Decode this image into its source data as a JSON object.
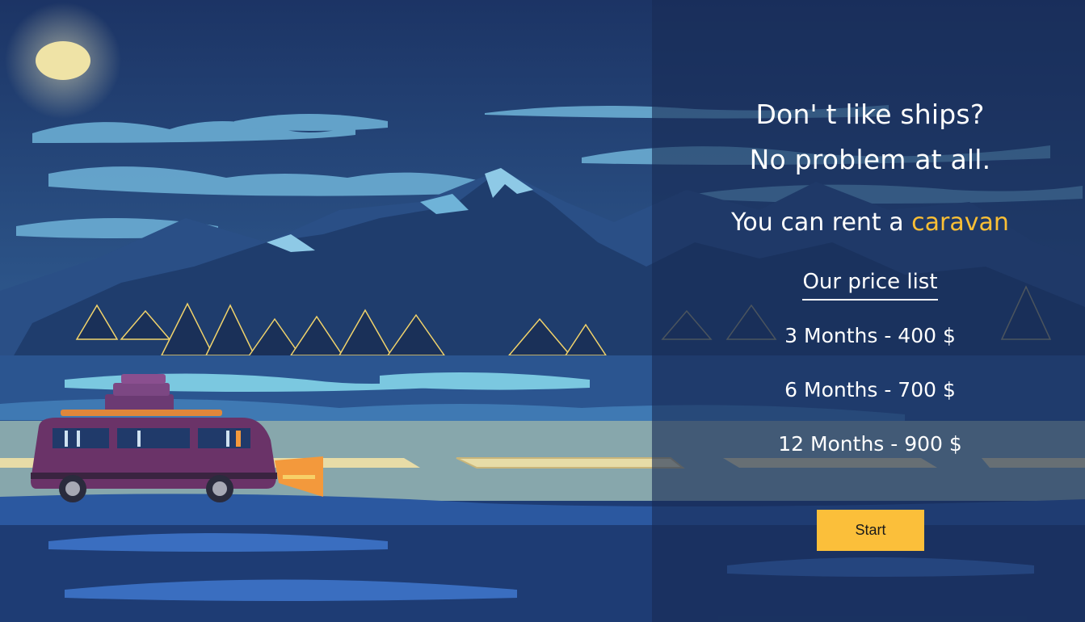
{
  "hero": {
    "headline_line1": "Don' t like ships?",
    "headline_line2": "No problem at all.",
    "subline_prefix": "You can rent a ",
    "subline_highlight": "caravan"
  },
  "prices": {
    "title": "Our price list",
    "items": [
      "3 Months - 400 $",
      "6 Months - 700 $",
      "12 Months - 900 $"
    ]
  },
  "cta": {
    "label": "Start"
  },
  "colors": {
    "accent": "#fbbf35",
    "panel": "#182c56",
    "night_sky": "#1d3461"
  }
}
